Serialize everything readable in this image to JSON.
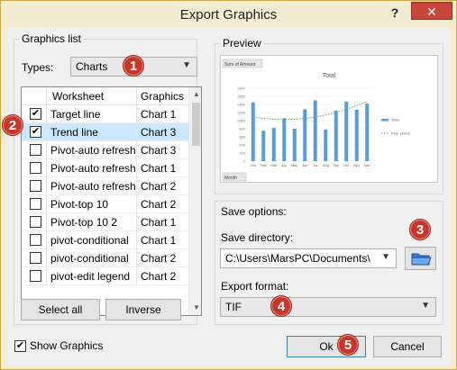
{
  "window": {
    "title": "Export Graphics",
    "help": "?",
    "close": "✕"
  },
  "graphics_list": {
    "legend": "Graphics list",
    "types_label": "Types:",
    "types_value": "Charts",
    "columns": [
      "Worksheet",
      "Graphics"
    ],
    "rows": [
      {
        "checked": true,
        "worksheet": "Target line",
        "graphics": "Chart 1",
        "selected": false
      },
      {
        "checked": true,
        "worksheet": "Trend line",
        "graphics": "Chart 3",
        "selected": true
      },
      {
        "checked": false,
        "worksheet": "Pivot-auto refresh",
        "graphics": "Chart 3",
        "selected": false
      },
      {
        "checked": false,
        "worksheet": "Pivot-auto refresh",
        "graphics": "Chart 1",
        "selected": false
      },
      {
        "checked": false,
        "worksheet": "Pivot-auto refresh",
        "graphics": "Chart 2",
        "selected": false
      },
      {
        "checked": false,
        "worksheet": "Pivot-top 10",
        "graphics": "Chart 2",
        "selected": false
      },
      {
        "checked": false,
        "worksheet": "Pivot-top 10 2",
        "graphics": "Chart 1",
        "selected": false
      },
      {
        "checked": false,
        "worksheet": "pivot-conditional",
        "graphics": "Chart 1",
        "selected": false
      },
      {
        "checked": false,
        "worksheet": "pivot-conditional",
        "graphics": "Chart 2",
        "selected": false
      },
      {
        "checked": false,
        "worksheet": "pivot-edit legend",
        "graphics": "Chart 2",
        "selected": false
      }
    ],
    "select_all": "Select all",
    "inverse": "Inverse"
  },
  "preview": {
    "legend": "Preview",
    "chart": {
      "field_button": "Sum of Amount",
      "title": "Total",
      "axis_button": "Month",
      "months": [
        "Jan",
        "Feb",
        "Mar",
        "Apr",
        "May",
        "Jun",
        "Jul",
        "Aug",
        "Sep",
        "Oct",
        "Nov",
        "Dec"
      ],
      "values": [
        1450,
        750,
        820,
        1060,
        800,
        1280,
        1500,
        780,
        1250,
        1470,
        1270,
        1420
      ],
      "y_ticks": [
        "1800",
        "1600",
        "1400",
        "1200",
        "1000",
        "800",
        "600",
        "400",
        "200",
        "0"
      ],
      "legend_total": "Total",
      "legend_trend": "Poly. (Total)",
      "bar_color": "#5b9bd5",
      "trend_color": "#6aa84f"
    }
  },
  "save_options": {
    "legend": "Save options:",
    "directory_label": "Save directory:",
    "directory_value": "C:\\Users\\MarsPC\\Documents\\",
    "format_label": "Export format:",
    "format_value": "TIF"
  },
  "footer": {
    "show_graphics": "Show Graphics",
    "show_graphics_checked": true,
    "ok": "Ok",
    "cancel": "Cancel"
  },
  "badges": [
    "1",
    "2",
    "3",
    "4",
    "5"
  ]
}
